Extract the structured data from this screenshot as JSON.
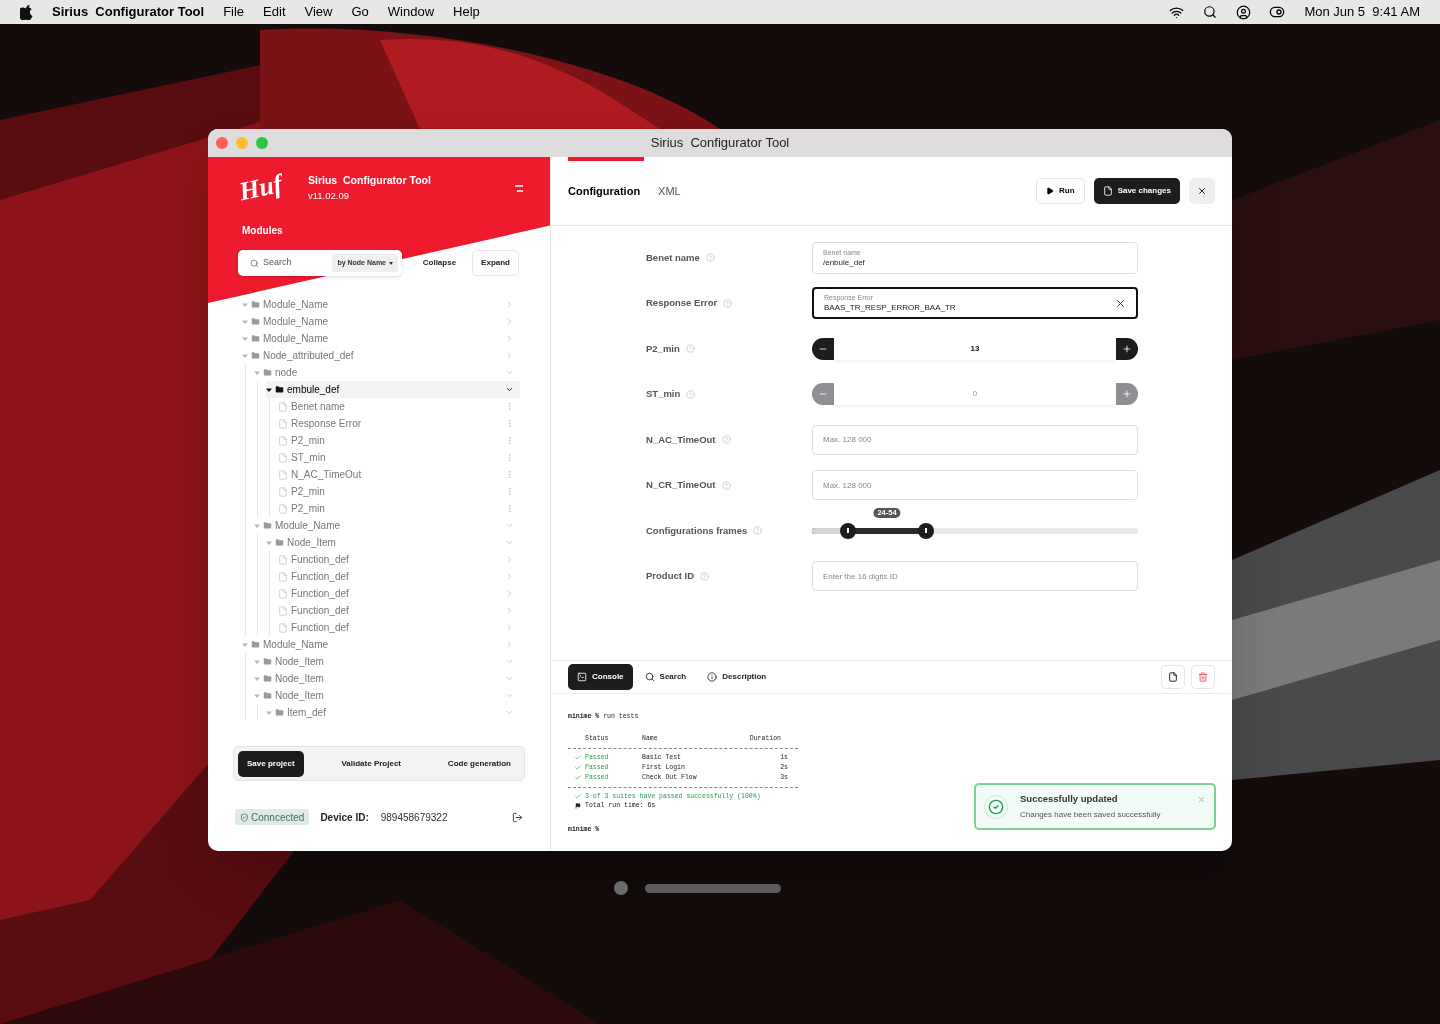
{
  "menubar": {
    "app": "Sirius  Configurator Tool",
    "menus": [
      "File",
      "Edit",
      "View",
      "Go",
      "Window",
      "Help"
    ],
    "clock": "Mon Jun 5  9:41 AM"
  },
  "window": {
    "title": "Sirius  Configurator Tool"
  },
  "sidebar": {
    "logo": "Huf",
    "app_name": "Sirius  Configurator Tool",
    "version": "v11.02.09",
    "section": "Modules",
    "search": {
      "placeholder": "Search",
      "filter": "by Node Name"
    },
    "tree_buttons": [
      {
        "label": "Collapse",
        "kind": "plain"
      },
      {
        "label": "Expand",
        "kind": "outlined"
      }
    ],
    "tree": [
      {
        "label": "Module_Name",
        "kind": "folder",
        "expanded": false,
        "selected": false
      },
      {
        "label": "Module_Name",
        "kind": "folder",
        "expanded": false,
        "selected": false
      },
      {
        "label": "Module_Name",
        "kind": "folder",
        "expanded": false,
        "selected": false
      },
      {
        "label": "Node_attributed_def",
        "kind": "folder",
        "expanded": false,
        "selected": false,
        "children": [
          {
            "label": "node",
            "kind": "folder",
            "expanded": true,
            "selected": false,
            "children": [
              {
                "label": "embule_def",
                "kind": "folder",
                "expanded": true,
                "selected": true,
                "children": [
                  {
                    "label": "Benet name",
                    "kind": "leaf",
                    "selected": false
                  },
                  {
                    "label": "Response Error",
                    "kind": "leaf",
                    "selected": false
                  },
                  {
                    "label": "P2_min",
                    "kind": "leaf",
                    "selected": false
                  },
                  {
                    "label": "ST_min",
                    "kind": "leaf",
                    "selected": false
                  },
                  {
                    "label": "N_AC_TimeOut",
                    "kind": "leaf",
                    "selected": false
                  },
                  {
                    "label": "P2_min",
                    "kind": "leaf",
                    "selected": false
                  },
                  {
                    "label": "P2_min",
                    "kind": "leaf",
                    "selected": false
                  }
                ]
              }
            ]
          },
          {
            "label": "Module_Name",
            "kind": "folder",
            "expanded": true,
            "selected": false,
            "children": [
              {
                "label": "Node_Item",
                "kind": "folder",
                "expanded": true,
                "selected": false,
                "children": [
                  {
                    "label": "Function_def",
                    "kind": "file",
                    "selected": false
                  },
                  {
                    "label": "Function_def",
                    "kind": "file",
                    "selected": false
                  },
                  {
                    "label": "Function_def",
                    "kind": "file",
                    "selected": false
                  },
                  {
                    "label": "Function_def",
                    "kind": "file",
                    "selected": false
                  },
                  {
                    "label": "Function_def",
                    "kind": "file",
                    "selected": false
                  }
                ]
              }
            ]
          }
        ]
      },
      {
        "label": "Module_Name",
        "kind": "folder",
        "expanded": false,
        "selected": false,
        "children": [
          {
            "label": "Node_Item",
            "kind": "folder",
            "expanded": true,
            "selected": false
          },
          {
            "label": "Node_Item",
            "kind": "folder",
            "expanded": true,
            "selected": false
          },
          {
            "label": "Node_Item",
            "kind": "folder",
            "expanded": true,
            "selected": false,
            "children": [
              {
                "label": "Item_def",
                "kind": "folder",
                "expanded": true,
                "selected": false
              }
            ]
          }
        ]
      }
    ],
    "actions": [
      {
        "label": "Save project",
        "selected": true
      },
      {
        "label": "Validate Project",
        "selected": false
      },
      {
        "label": "Code generation",
        "selected": false
      }
    ],
    "status": {
      "badge": "Conncected",
      "device_label": "Device ID:",
      "device_id": "989458679322"
    }
  },
  "tabs": [
    {
      "label": "Configuration",
      "selected": true
    },
    {
      "label": "XML",
      "selected": false
    }
  ],
  "toolbar": {
    "run": "Run",
    "save": "Save changes"
  },
  "fields": [
    {
      "kind": "text",
      "label": "Benet name",
      "floating_label": "Benet name",
      "value": "/enbule_def",
      "focused": false
    },
    {
      "kind": "text",
      "label": "Response Error",
      "floating_label": "Response Error",
      "value": "BAAS_TR_RESP_ERROR_BAA_TR",
      "focused": true
    },
    {
      "kind": "stepper",
      "label": "P2_min",
      "value": "13",
      "disabled": false
    },
    {
      "kind": "stepper",
      "label": "ST_min",
      "value": "0",
      "disabled": true
    },
    {
      "kind": "input",
      "label": "N_AC_TimeOut",
      "placeholder": "Max. 128 000"
    },
    {
      "kind": "input",
      "label": "N_CR_TimeOut",
      "placeholder": "Max. 128 000"
    },
    {
      "kind": "range",
      "label": "Configurations frames",
      "reading": "24-54",
      "start": {
        "level": 0.11
      },
      "end": {
        "level": 0.35
      }
    },
    {
      "kind": "input",
      "label": "Product ID",
      "placeholder": "Enter the 16 digits ID"
    }
  ],
  "console_panel": {
    "tabs": [
      {
        "label": "Console",
        "selected": true
      },
      {
        "label": "Search",
        "selected": false
      },
      {
        "label": "Description",
        "selected": false
      }
    ],
    "prompt": "minime %",
    "command": "run tests",
    "columns": [
      "Status",
      "Name",
      "Duration"
    ],
    "rows": [
      {
        "status": "Passed",
        "kind": "passed",
        "name": "Basic Test",
        "duration": "1s"
      },
      {
        "status": "Passed",
        "kind": "passed",
        "name": "First Login",
        "duration": "2s"
      },
      {
        "status": "Passed",
        "kind": "passed",
        "name": "Check Out Flow",
        "duration": "3s"
      }
    ],
    "summary": "3 of 3 suites have passed successfully (100%)",
    "runtime": "Total run time: 6s",
    "final_prompt": "minime %"
  },
  "toast": {
    "title": "Successfully updated",
    "message": "Changes have been saved successfully"
  }
}
